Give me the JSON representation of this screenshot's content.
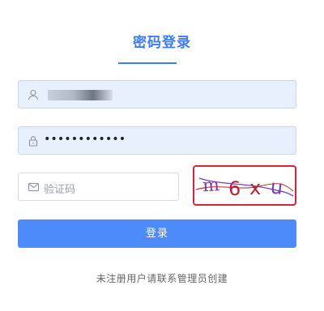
{
  "tab": {
    "title": "密码登录",
    "accent": "#3b7cff"
  },
  "username": {
    "icon": "user-icon",
    "masked": true
  },
  "password": {
    "icon": "lock-icon",
    "value": "••••••••••••"
  },
  "captcha": {
    "icon": "mail-icon",
    "placeholder": "验证码",
    "image_text": [
      "m",
      "6",
      "x",
      "u"
    ],
    "image_colors": [
      "#7a3fb8",
      "#c2202a",
      "#c2202a",
      "#7a3fb8"
    ]
  },
  "login_button": {
    "label": "登录",
    "color": "#4d8bfb"
  },
  "footer": {
    "note": "未注册用户请联系管理员创建"
  }
}
